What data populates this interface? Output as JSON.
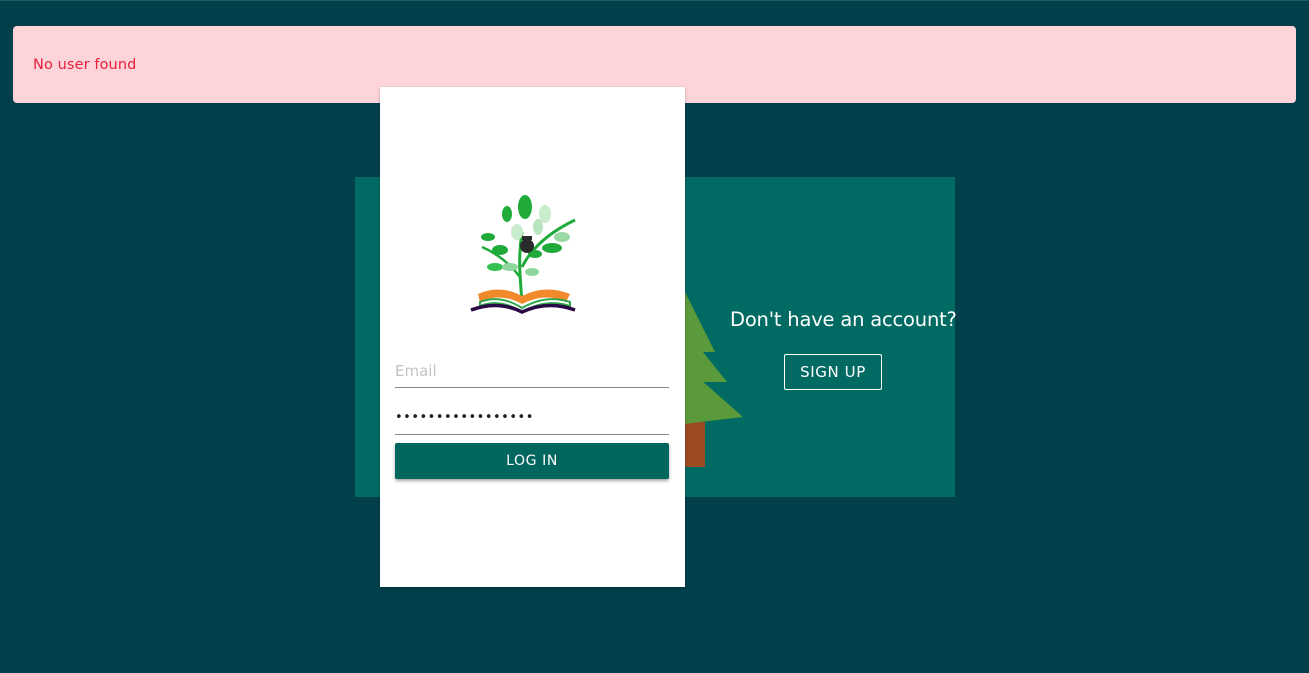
{
  "alert": {
    "message": "No user found",
    "color": "#e8203a",
    "background": "#fdd4da"
  },
  "login": {
    "logo_icon": "tree-book-logo-icon",
    "email_placeholder": "Email",
    "email_value": "",
    "password_value": "•••••••••••••••••",
    "login_label": "LOG IN"
  },
  "signup": {
    "prompt": "Don't have an account?",
    "button_label": "SIGN UP"
  },
  "colors": {
    "page_background": "#013f4a",
    "panel_background": "#006a63",
    "button_background": "#00665e",
    "tree_green": "#5b9a3a",
    "tree_trunk": "#9c4a24"
  }
}
